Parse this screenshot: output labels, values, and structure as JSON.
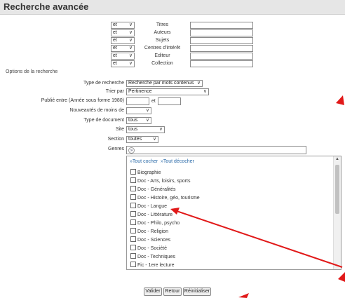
{
  "page_title": "Recherche avancée",
  "criteria": [
    {
      "op": "et",
      "label": "Titres"
    },
    {
      "op": "et",
      "label": "Auteurs"
    },
    {
      "op": "et",
      "label": "Sujets"
    },
    {
      "op": "et",
      "label": "Centres d'intérêt"
    },
    {
      "op": "et",
      "label": "Editeur"
    },
    {
      "op": "et",
      "label": "Collection"
    }
  ],
  "options_title": "Options de la recherche",
  "fields": {
    "type_recherche": {
      "label": "Type de recherche",
      "value": "Recherche par mots contenus"
    },
    "trier_par": {
      "label": "Trier par",
      "value": "Pertinence"
    },
    "publie_entre": {
      "label": "Publié entre (Année sous forme 1980)",
      "sep": "et"
    },
    "nouveautes": {
      "label": "Nouveautés de moins de",
      "value": ""
    },
    "type_document": {
      "label": "Type de document",
      "value": "tous"
    },
    "site": {
      "label": "Site",
      "value": "tous"
    },
    "section": {
      "label": "Section",
      "value": "toutes"
    },
    "genres": {
      "label": "Genres"
    }
  },
  "genres_list": {
    "check_all": "»Tout cocher",
    "uncheck_all": "»Tout décocher",
    "items": [
      "Biographie",
      "Doc - Arts, loisirs, sports",
      "Doc - Généralités",
      "Doc - Histoire, géo, tourisme",
      "Doc - Langue",
      "Doc - Littérature",
      "Doc - Philo, psycho",
      "Doc - Religion",
      "Doc - Sciences",
      "Doc - Société",
      "Doc - Techniques",
      "Fic - 1ere lecture"
    ]
  },
  "buttons": {
    "valider": "Valider",
    "retour": "Retour",
    "reinitialiser": "Réinitialiser"
  },
  "colors": {
    "annotation_arrow": "#e11919",
    "link": "#2a6aa8"
  },
  "icons": {
    "chevron": "chevron-down-icon",
    "genres": "expand-icon"
  }
}
